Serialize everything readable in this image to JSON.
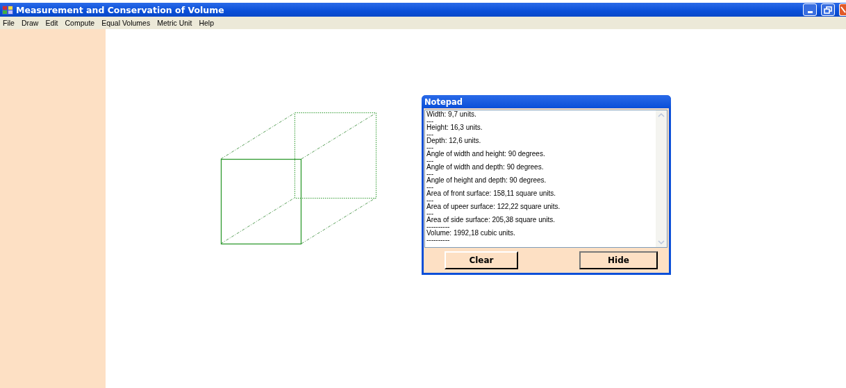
{
  "window": {
    "title": "Measurement and Conservation of Volume"
  },
  "menu": [
    "File",
    "Draw",
    "Edit",
    "Compute",
    "Equal Volumes",
    "Metric Unit",
    "Help"
  ],
  "notepad": {
    "title": "Notepad",
    "lines": [
      "Width: 9,7 units.",
      "---",
      "Height: 16,3 units.",
      "---",
      "Depth: 12,6 units.",
      "---",
      "Angle of width and height: 90 degrees.",
      "---",
      "Angle of width and depth: 90 degrees.",
      "---",
      "Angle of height and depth: 90 degrees.",
      "---",
      "Area of front surface: 158,11 square units.",
      "---",
      "Area of upeer surface: 122,22 square units.",
      "---",
      "Area of side surface: 205,38 square units.",
      "----------",
      "Volume: 1992,18 cubic units.",
      "----------"
    ],
    "buttons": [
      "Clear",
      "Hide"
    ]
  }
}
